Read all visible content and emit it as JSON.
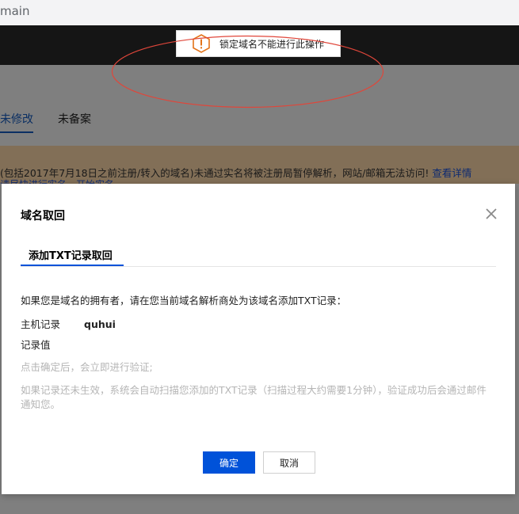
{
  "browser": {
    "url_fragment": "main"
  },
  "toast": {
    "message": "锁定域名不能进行此操作",
    "icon": "warning-icon",
    "icon_color": "#e37318"
  },
  "tabs": [
    {
      "label": "未修改"
    },
    {
      "label": "未备案"
    }
  ],
  "notice": {
    "text": "(包括2017年7月18日之前注册/转入的域名)未通过实名将被注册局暂停解析，网站/邮箱无法访问!",
    "link": "查看详情",
    "sub_text": "请尽快进行实名，开始实名"
  },
  "modal": {
    "title": "域名取回",
    "close_icon": "close-icon",
    "tab_label": "添加TXT记录取回",
    "description": "如果您是域名的拥有者，请在您当前域名解析商处为该域名添加TXT记录：",
    "host_label": "主机记录",
    "host_value": "quhui",
    "record_label": "记录值",
    "hint1": "点击确定后，会立即进行验证;",
    "hint2": "如果记录还未生效，系统会自动扫描您添加的TXT记录（扫描过程大约需要1分钟），验证成功后会通过邮件通知您。",
    "ok_label": "确定",
    "cancel_label": "取消"
  },
  "colors": {
    "primary": "#0052d9",
    "annotation": "#e0463a"
  }
}
